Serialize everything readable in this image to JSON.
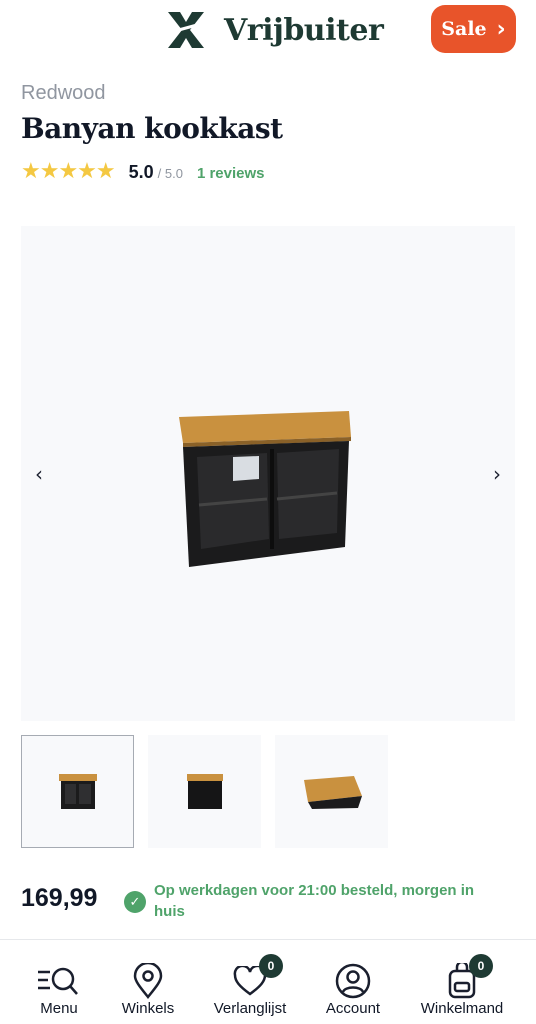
{
  "header": {
    "logo_text": "Vrijbuiter",
    "sale_label": "Sale"
  },
  "product": {
    "brand": "Redwood",
    "title": "Banyan kookkast",
    "rating": {
      "stars": "★★★★★",
      "score": "5.0",
      "out_of": "/ 5.0",
      "reviews": "1 reviews",
      "value": 5.0
    },
    "price": "169,99",
    "delivery": "Op werkdagen voor 21:00 besteld, morgen in huis"
  },
  "gallery": {
    "thumbnail_count": 3,
    "active_index": 0
  },
  "nav": {
    "items": [
      {
        "label": "Menu",
        "icon": "menu-search-icon"
      },
      {
        "label": "Winkels",
        "icon": "location-pin-icon"
      },
      {
        "label": "Verlanglijst",
        "icon": "heart-icon",
        "badge": "0"
      },
      {
        "label": "Account",
        "icon": "user-circle-icon"
      },
      {
        "label": "Winkelmand",
        "icon": "backpack-icon",
        "badge": "0"
      }
    ]
  },
  "colors": {
    "brand_dark": "#1e3a33",
    "sale": "#e8542a",
    "success": "#4fa36a",
    "star": "#f4c842"
  }
}
